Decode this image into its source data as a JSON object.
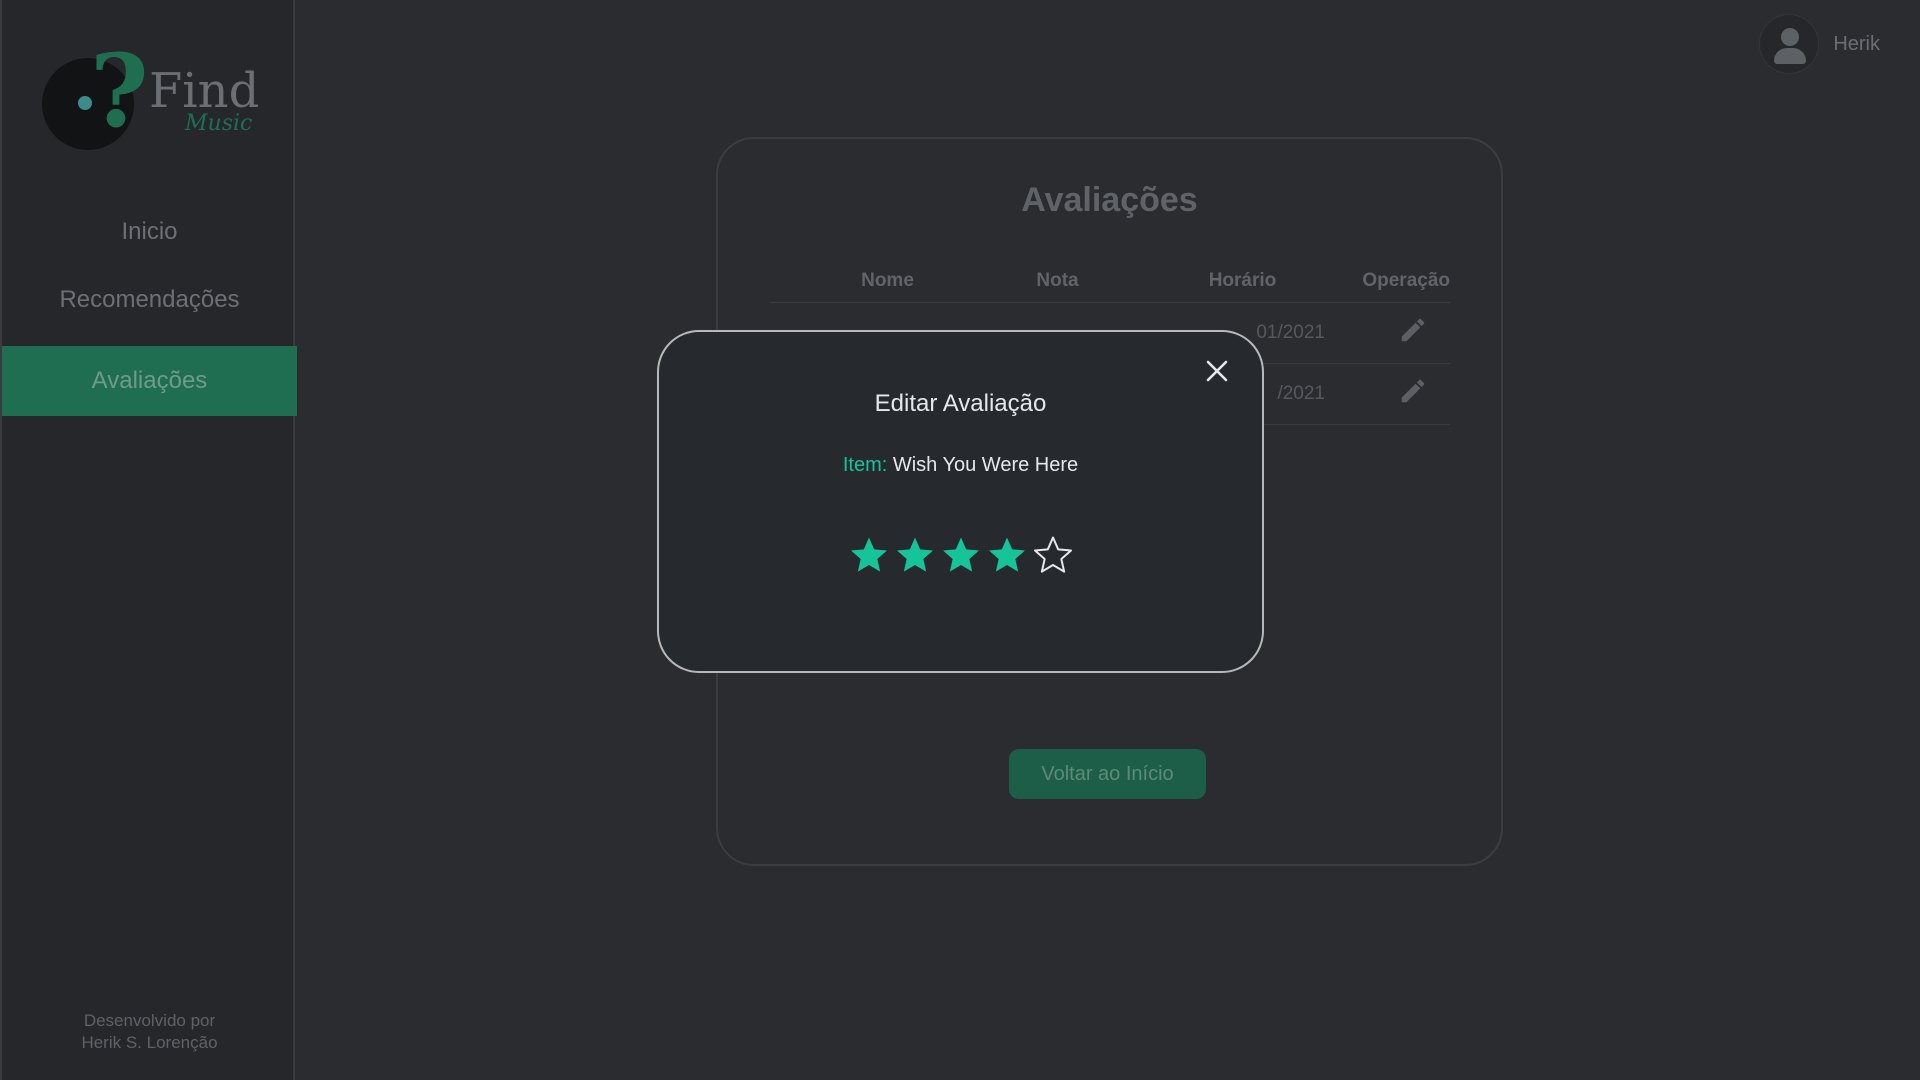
{
  "brand": {
    "name": "Find",
    "subtitle": "Music"
  },
  "sidebar": {
    "items": [
      {
        "label": "Inicio",
        "active": false
      },
      {
        "label": "Recomendações",
        "active": false
      },
      {
        "label": "Avaliações",
        "active": true
      }
    ],
    "footer": {
      "line1": "Desenvolvido por",
      "line2": "Herik S. Lorenção"
    }
  },
  "user": {
    "name": "Herik",
    "icon": "user-avatar-icon"
  },
  "page": {
    "title": "Avaliações",
    "table": {
      "headers": [
        "Nome",
        "Nota",
        "Horário",
        "Operação"
      ],
      "rows": [
        {
          "date_fragment": "01/2021",
          "action_icon": "pencil-icon"
        },
        {
          "date_fragment": "/2021",
          "action_icon": "pencil-icon"
        }
      ]
    },
    "back_button": "Voltar ao Início"
  },
  "modal": {
    "title": "Editar Avaliação",
    "item_label": "Item:",
    "item_value": "Wish You Were Here",
    "rating": 4,
    "max_rating": 5,
    "close_icon": "close-icon"
  },
  "colors": {
    "accent": "#17c49a",
    "active_nav_bg": "#1f6e52",
    "background": "#2b2c2f",
    "modal_bg": "#262a2f",
    "modal_border": "#b6b9bc"
  }
}
